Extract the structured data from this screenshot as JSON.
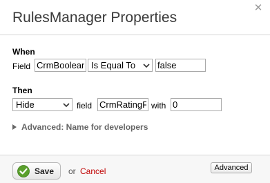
{
  "dialog": {
    "title": "RulesManager Properties",
    "close_icon": "close-icon"
  },
  "when": {
    "heading": "When",
    "field_label": "Field",
    "field_value": "CrmBoolean",
    "operator": "Is Equal To",
    "compare_value": "false"
  },
  "then": {
    "heading": "Then",
    "action": "Hide",
    "field_label": "field",
    "target_field": "CrmRatingF",
    "with_label": "with",
    "with_value": "0"
  },
  "advanced": {
    "toggle_label": "Advanced: Name for developers"
  },
  "footer": {
    "save_label": "Save",
    "or_label": "or",
    "cancel_label": "Cancel",
    "advanced_button_label": "Advanced"
  },
  "colors": {
    "accent_green": "#5aa02c",
    "cancel_red": "#c00000"
  }
}
